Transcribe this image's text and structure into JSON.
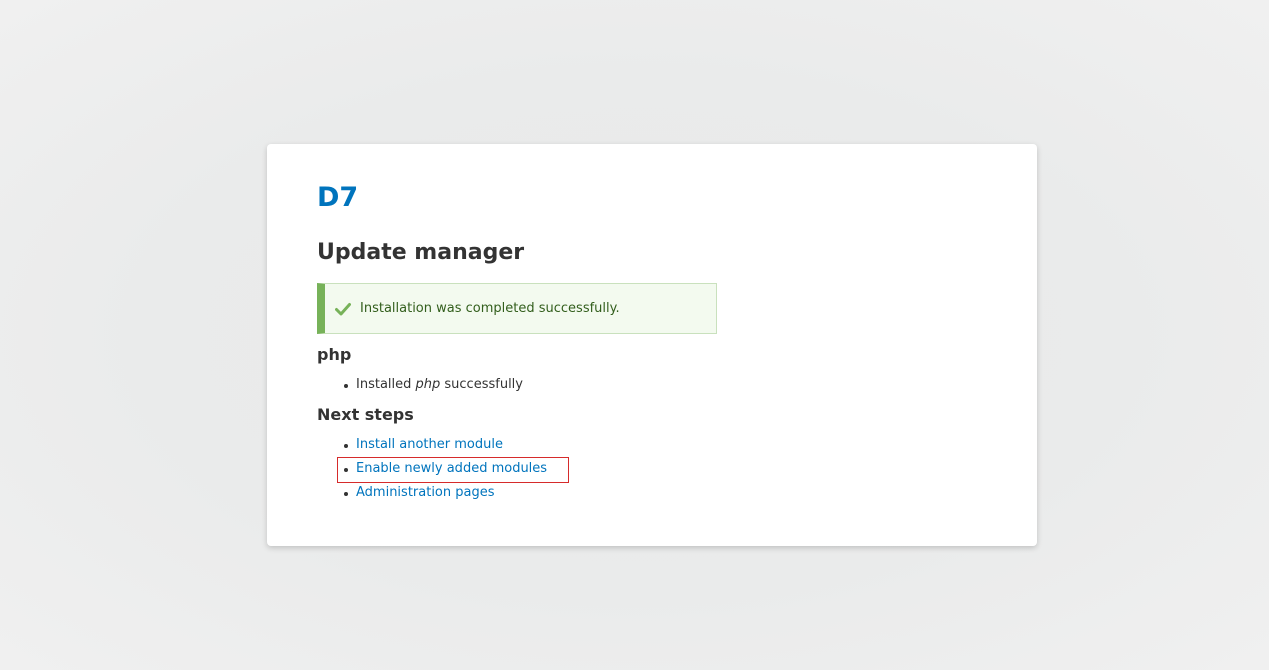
{
  "site": {
    "name": "D7"
  },
  "page": {
    "title": "Update manager"
  },
  "status_message": {
    "text": "Installation was completed successfully.",
    "icon": "check-icon",
    "accent_color": "#77b259"
  },
  "installed_section": {
    "heading": "php",
    "items": [
      {
        "prefix": "Installed ",
        "emphasis": "php",
        "suffix": " successfully"
      }
    ]
  },
  "next_steps": {
    "heading": "Next steps",
    "links": [
      {
        "label": "Install another module"
      },
      {
        "label": "Enable newly added modules"
      },
      {
        "label": "Administration pages"
      }
    ]
  },
  "colors": {
    "link": "#0074bd",
    "highlight": "#d62b2b"
  }
}
